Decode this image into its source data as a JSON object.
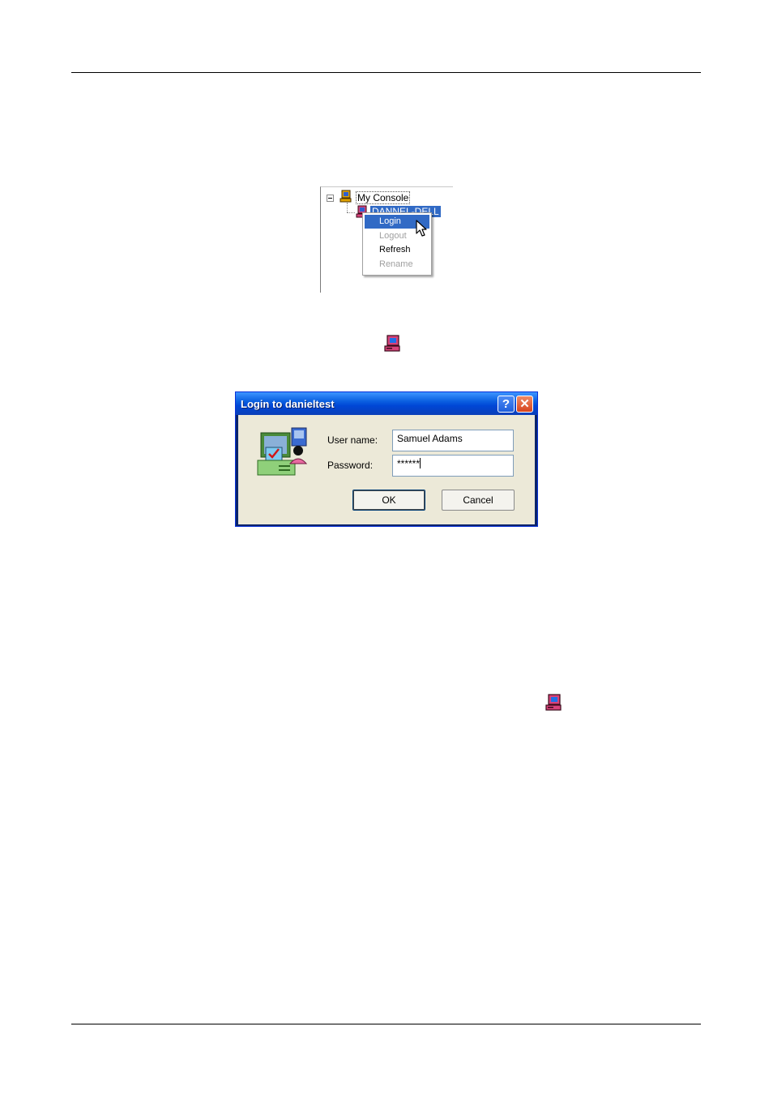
{
  "tree": {
    "root_label": "My Console",
    "child_label": "DANNEL-DELL",
    "menu": [
      {
        "label": "Login",
        "state": "highlighted"
      },
      {
        "label": "Logout",
        "state": "disabled"
      },
      {
        "label": "Refresh",
        "state": "enabled"
      },
      {
        "label": "Rename",
        "state": "disabled"
      }
    ]
  },
  "icons": {
    "console_icon": "computer-icon",
    "inline_icon": "remote-computer-icon"
  },
  "dialog": {
    "title": "Login to danieltest",
    "help_glyph": "?",
    "close_glyph": "✕",
    "username_label": "User name:",
    "username_value": "Samuel Adams",
    "password_label": "Password:",
    "password_value": "******",
    "ok_label": "OK",
    "cancel_label": "Cancel"
  },
  "colors": {
    "selection": "#316ac5",
    "title_bar": "#0046d5",
    "dialog_face": "#ece9d8"
  }
}
